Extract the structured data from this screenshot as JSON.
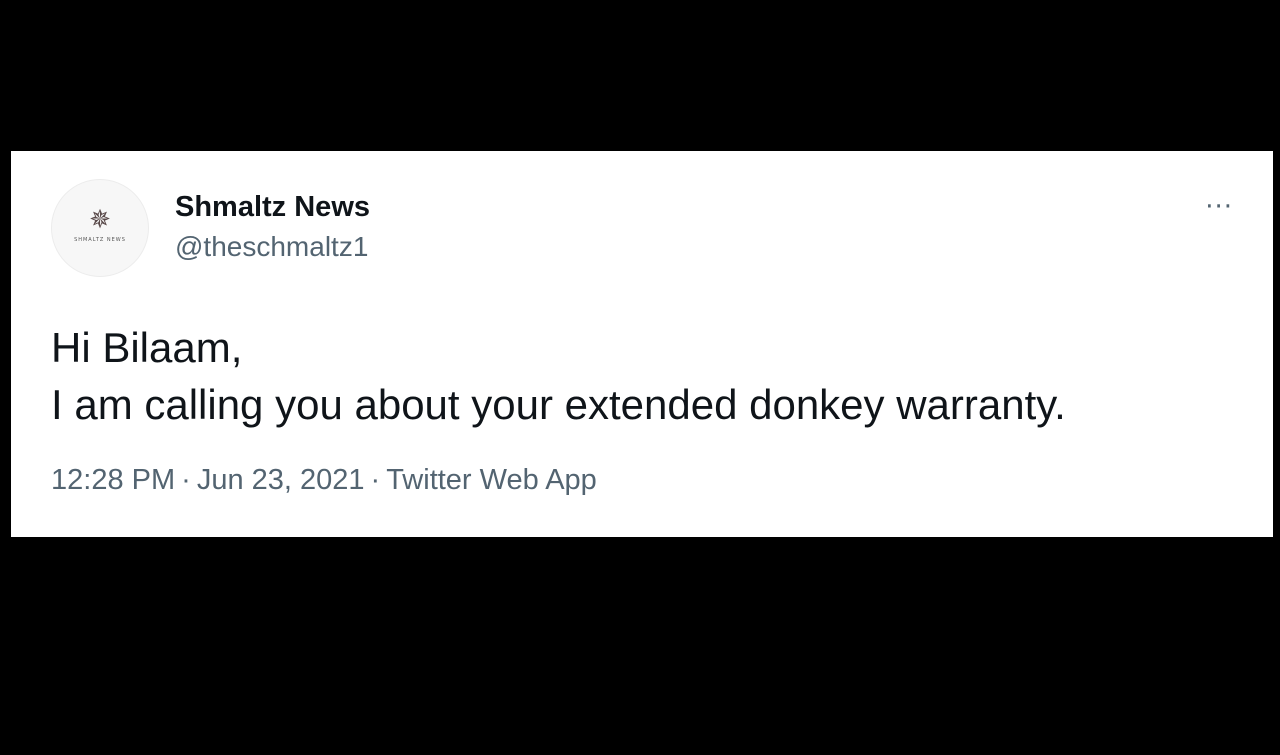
{
  "tweet": {
    "author": {
      "display_name": "Shmaltz News",
      "handle": "@theschmaltz1",
      "avatar_icon": "star-logo-icon",
      "avatar_caption": "SHMALTZ NEWS"
    },
    "more_icon": "more-options-icon",
    "more_label": "···",
    "text_lines": [
      "Hi Bilaam,",
      "I am calling you about your extended donkey warranty."
    ],
    "time": "12:28 PM",
    "date": "Jun 23, 2021",
    "source": "Twitter Web App",
    "separator": "·"
  },
  "colors": {
    "background": "#000000",
    "card": "#ffffff",
    "primary_text": "#0f1419",
    "secondary_text": "#536471"
  }
}
